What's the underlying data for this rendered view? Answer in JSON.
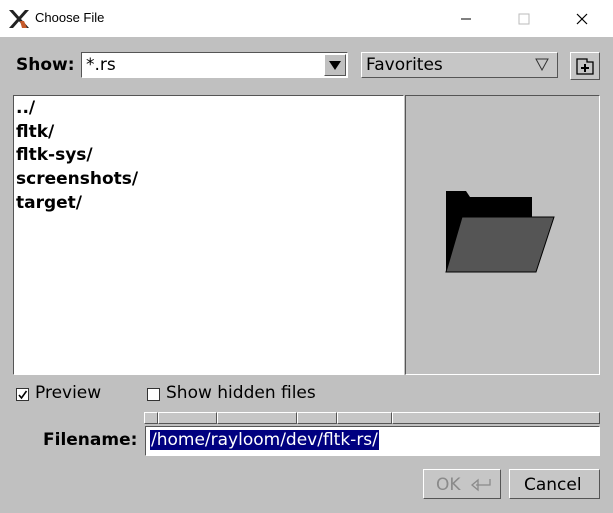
{
  "window": {
    "title": "Choose File",
    "app_icon": "x-logo-icon",
    "controls": [
      "minimize-icon",
      "maximize-icon",
      "close-icon"
    ]
  },
  "toolbar": {
    "show_label": "Show:",
    "filter_value": "*.rs",
    "favorites_label": "Favorites",
    "new_folder_icon": "new-folder-icon"
  },
  "file_list": {
    "items": [
      "../",
      "fltk/",
      "fltk-sys/",
      "screenshots/",
      "target/"
    ]
  },
  "preview": {
    "icon": "folder-icon"
  },
  "options": {
    "preview_label": "Preview",
    "preview_checked": true,
    "hidden_label": "Show hidden files",
    "hidden_checked": false
  },
  "filename": {
    "label": "Filename:",
    "value": "/home/rayloom/dev/fltk-rs/"
  },
  "buttons": {
    "ok_label": "OK",
    "ok_icon": "return-arrow-icon",
    "cancel_label": "Cancel"
  }
}
